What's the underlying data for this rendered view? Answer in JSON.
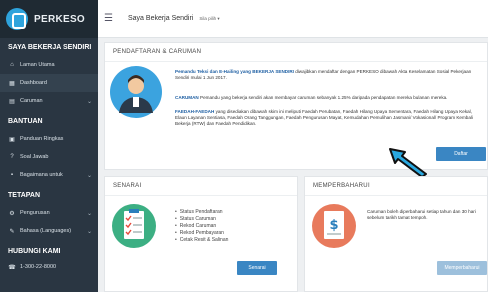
{
  "app": {
    "brand": "PERKESO",
    "header_title": "Saya Bekerja Sendiri",
    "header_dropdown": "Sila pilih ▾"
  },
  "sidebar": {
    "section1": "SAYA BEKERJA SENDIRI",
    "items1": [
      {
        "icon": "home-icon",
        "label": "Laman Utama"
      },
      {
        "icon": "dashboard-icon",
        "label": "Dashboard"
      },
      {
        "icon": "contribution-icon",
        "label": "Caruman"
      }
    ],
    "section2": "BANTUAN",
    "items2": [
      {
        "icon": "guide-icon",
        "label": "Panduan Ringkas"
      },
      {
        "icon": "question-icon",
        "label": "Soal Jawab"
      },
      {
        "icon": "howto-icon",
        "label": "Bagaimana untuk"
      }
    ],
    "section3": "TETAPAN",
    "items3": [
      {
        "icon": "gear-icon",
        "label": "Pengurusan"
      },
      {
        "icon": "language-icon",
        "label": "Bahasa (Languages)"
      }
    ],
    "section4": "HUBUNGI KAMI",
    "phone": "1-300-22-8000"
  },
  "registration": {
    "title": "PENDAFTARAN & CARUMAN",
    "para1_bold": "Pemandu Teksi dan E-Hailing yang BEKERJA SENDIRI",
    "para1_rest": " diwajibkan mendaftar dengan PERKESO dibawah Akta Keselamatan Sosial Pekerjaan Sendiri mulai 1 Jun 2017.",
    "para2_bold": "CARUMAN",
    "para2_rest": " Pemandu yang bekerja sendiri akan membayar caruman sebanyak 1.25% daripada pendapatan mereka bulanan mereka.",
    "para3_bold": "FAEDAH-FAEDAH",
    "para3_rest": " yang disediakan dibawah skim ini meliputi Faedah Perubatan, Faedah Hilang Upaya Sementara, Faedah Hilang Upaya Kekal, Elaun Layanan Sentiasa, Faedah Orang Tanggungan, Faedah Pengurusan Mayat, Kemudahan Pemulihan Jasmani/ Vokasional/ Program Kembali Bekerja (RTW) dan Faedah Pendidikan.",
    "button": "Daftar"
  },
  "senarai": {
    "title": "SENARAI",
    "items": [
      "Status Pendaftaran",
      "Status Caruman",
      "Rekod Caruman",
      "Rekod Pembayaran",
      "Cetak Resit & Salinan"
    ],
    "button": "Senarai"
  },
  "update": {
    "title": "MEMPERBAHARUI",
    "text": "Caruman boleh diperbaharui setiap tahun dan 30 hari sebelum tarikh tamat tempoh.",
    "button": "Memperbaharui"
  },
  "colors": {
    "sidebar": "#2a3642",
    "accent": "#3a86c3",
    "arrow": "#29a8e0"
  }
}
